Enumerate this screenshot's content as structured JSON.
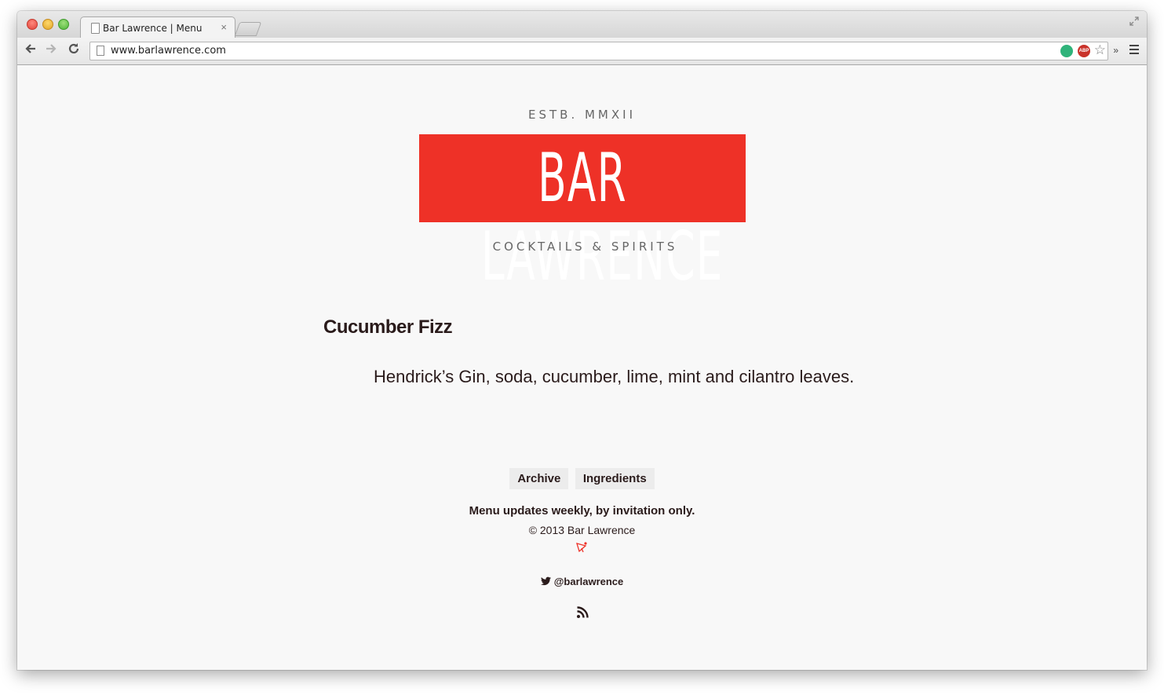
{
  "browser": {
    "tab_title": "Bar Lawrence | Menu",
    "tab_close_glyph": "×",
    "url": "www.barlawrence.com",
    "extensions": [
      "hola-icon",
      "adblock-plus-icon"
    ],
    "abp_label": "ABP",
    "overflow_glyph": "»"
  },
  "site": {
    "established": "ESTB. MMXII",
    "logo_text": "BAR LAWRENCE",
    "tagline": "COCKTAILS & SPIRITS"
  },
  "drink": {
    "name": "Cucumber Fizz",
    "description": "Hendrick’s Gin, soda, cucumber, lime, mint and cilantro leaves."
  },
  "footer": {
    "links": [
      "Archive",
      "Ingredients"
    ],
    "note": "Menu updates weekly, by invitation only.",
    "copyright": "© 2013 Bar Lawrence",
    "twitter_handle": "@barlawrence"
  },
  "colors": {
    "brand_red": "#ee3127",
    "text_dark": "#2a1b1b",
    "page_background": "#f8f8f8"
  }
}
